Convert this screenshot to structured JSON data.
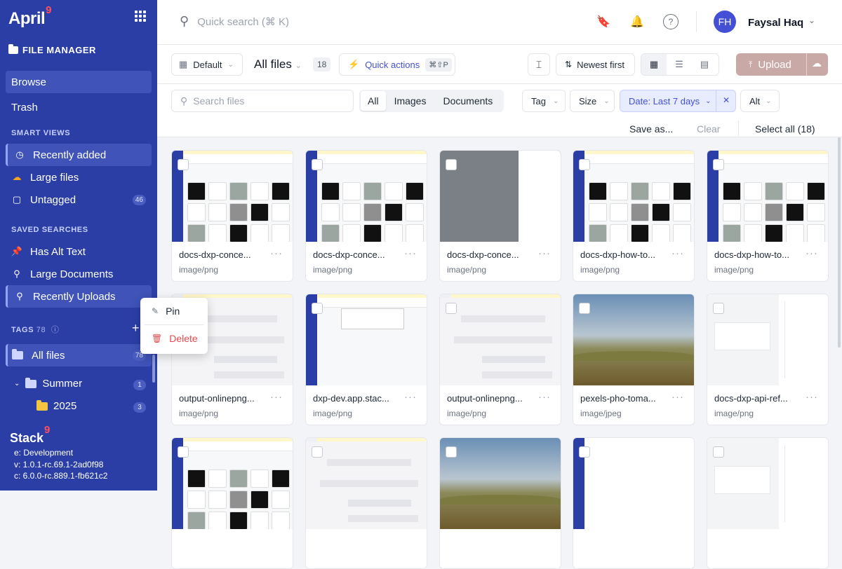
{
  "app": {
    "name": "April",
    "sup": "9",
    "section_title": "FILE MANAGER"
  },
  "nav": {
    "browse": "Browse",
    "trash": "Trash"
  },
  "smart_views": {
    "title": "SMART VIEWS",
    "items": [
      {
        "label": "Recently added"
      },
      {
        "label": "Large files"
      },
      {
        "label": "Untagged",
        "count": "46"
      }
    ]
  },
  "saved_searches": {
    "title": "SAVED SEARCHES",
    "items": [
      {
        "label": "Has Alt Text"
      },
      {
        "label": "Large Documents"
      },
      {
        "label": "Recently Uploads"
      }
    ]
  },
  "tags": {
    "title": "TAGS",
    "count": "78"
  },
  "tree": {
    "all_files": "All files",
    "all_count": "78",
    "summer": "Summer",
    "summer_count": "1",
    "y2025": "2025",
    "y2025_count": "3"
  },
  "context_menu": {
    "pin": "Pin",
    "delete": "Delete"
  },
  "footer": {
    "brand": "Stack",
    "sup": "9",
    "env": "e: Development",
    "v": "v: 1.0.1-rc.69.1-2ad0f98",
    "c": "c: 6.0.0-rc.889.1-fb621c2"
  },
  "header": {
    "search_placeholder": "Quick search (⌘ K)",
    "user_initials": "FH",
    "user_name": "Faysal Haq"
  },
  "toolbar": {
    "view": "Default",
    "title": "All files",
    "count": "18",
    "quick_actions": "Quick actions",
    "shortcut": "⌘⇧P",
    "sort": "Newest first",
    "upload": "Upload"
  },
  "filters": {
    "search_placeholder": "Search files",
    "segments": [
      "All",
      "Images",
      "Documents"
    ],
    "tag": "Tag",
    "size": "Size",
    "date": "Date: Last 7 days",
    "alt": "Alt"
  },
  "subbar": {
    "save_as": "Save as...",
    "clear": "Clear",
    "select_all": "Select all (18)"
  },
  "colors": {
    "sidebar": "#2b3ea6",
    "accent": "#4350d6",
    "upload": "#c9a9a6",
    "danger": "#e5484d"
  },
  "files": [
    {
      "name": "docs-dxp-conce...",
      "type": "image/png"
    },
    {
      "name": "docs-dxp-conce...",
      "type": "image/png"
    },
    {
      "name": "docs-dxp-conce...",
      "type": "image/png"
    },
    {
      "name": "docs-dxp-how-to...",
      "type": "image/png"
    },
    {
      "name": "docs-dxp-how-to...",
      "type": "image/png"
    },
    {
      "name": "output-onlinepng...",
      "type": "image/png"
    },
    {
      "name": "dxp-dev.app.stac...",
      "type": "image/png"
    },
    {
      "name": "output-onlinepng...",
      "type": "image/png"
    },
    {
      "name": "pexels-pho-toma...",
      "type": "image/jpeg"
    },
    {
      "name": "docs-dxp-api-ref...",
      "type": "image/png"
    },
    {
      "name": "",
      "type": ""
    },
    {
      "name": "",
      "type": ""
    },
    {
      "name": "",
      "type": ""
    },
    {
      "name": "",
      "type": ""
    },
    {
      "name": "",
      "type": ""
    }
  ]
}
